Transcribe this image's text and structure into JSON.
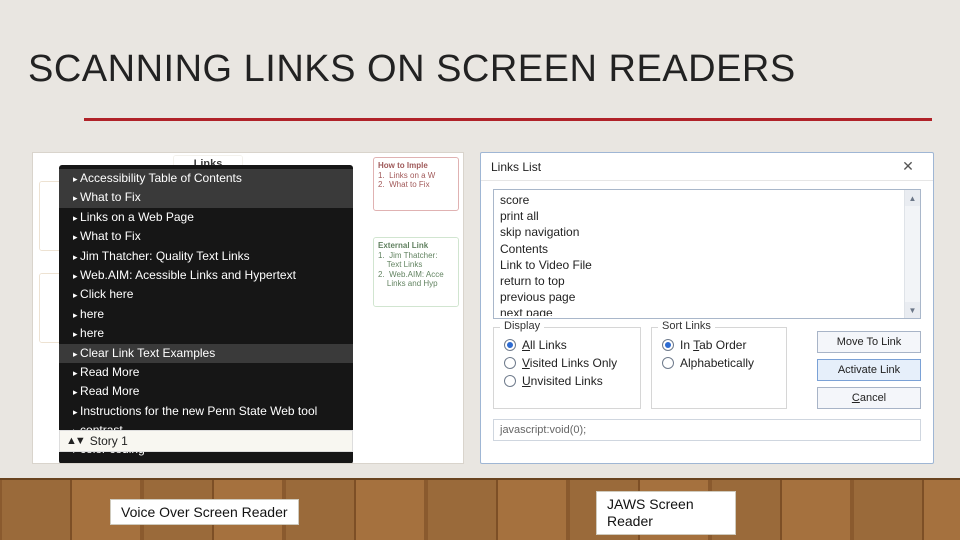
{
  "slide": {
    "title": "SCANNING LINKS ON SCREEN READERS"
  },
  "voiceover": {
    "bg_title": "Links",
    "bg_howto_title": "How to Imple",
    "bg_howto_items": "1.  Links on a W\n2.  What to Fix",
    "bg_external_title": "External Link",
    "bg_external_items": "1.  Jim Thatcher:\n    Text Links\n2.  Web.AIM: Acce\n    Links and Hyp",
    "items": [
      "Accessibility Table of Contents",
      "What to Fix",
      "Links on a Web Page",
      "What to Fix",
      "Jim Thatcher: Quality Text Links",
      "Web.AIM: Acessible Links and Hypertext",
      "Click here",
      "here",
      "here",
      "Clear Link Text Examples",
      "Read More",
      "Read More",
      "Instructions for the new Penn State Web tool",
      "contrast",
      "color coding"
    ],
    "footer": "Story 1",
    "caption": "Voice Over Screen Reader"
  },
  "jaws": {
    "window_title": "Links List",
    "list_items": [
      "score",
      "print all",
      "skip navigation",
      "Contents",
      "Link to Video File",
      "return to top",
      "previous page",
      "next page"
    ],
    "display_legend": "Display",
    "display_options": {
      "all": "All Links",
      "visited": "Visited Links Only",
      "unvisited": "Unvisited Links"
    },
    "sort_legend": "Sort Links",
    "sort_options": {
      "tab": "In Tab Order",
      "alpha": "Alphabetically"
    },
    "buttons": {
      "move": "Move To Link",
      "activate": "Activate Link",
      "cancel": "Cancel"
    },
    "js_field": "javascript:void(0);",
    "caption": "JAWS Screen Reader"
  }
}
